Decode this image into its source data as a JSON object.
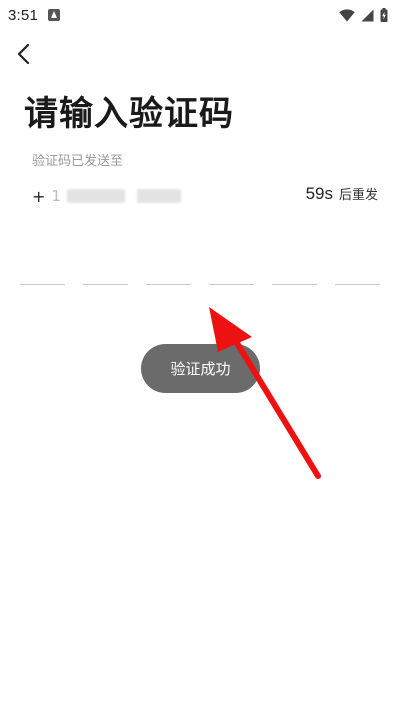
{
  "status_bar": {
    "time": "3:51",
    "icons": [
      "app-notification-icon",
      "wifi-icon",
      "signal-icon",
      "battery-charging-icon"
    ]
  },
  "nav": {
    "back_icon": "chevron-left-icon"
  },
  "page": {
    "title": "请输入验证码",
    "sent_hint": "验证码已发送至",
    "phone_prefix": "+",
    "phone_number_visible": "1",
    "countdown": "59s",
    "resend_label": "后重发"
  },
  "code_input": {
    "digits": [
      "",
      "",
      "",
      "",
      "",
      ""
    ]
  },
  "toast": {
    "message": "验证成功"
  },
  "annotation": {
    "arrow_color": "#ee1111"
  },
  "colors": {
    "background": "#ffffff",
    "title": "#1a1a1a",
    "hint": "#9a9a9a",
    "toast_bg": "#6b6b6b",
    "underline": "#c8c8c8"
  }
}
